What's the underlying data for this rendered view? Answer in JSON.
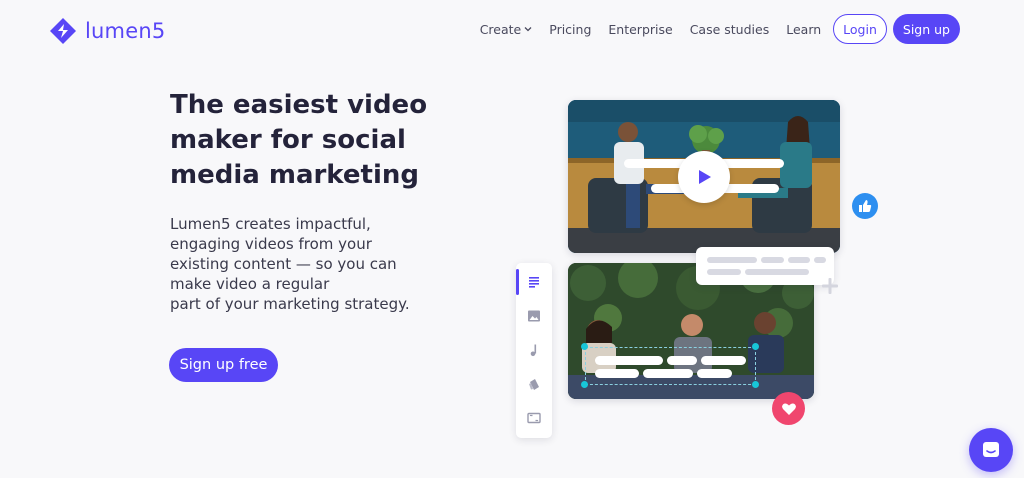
{
  "brand": {
    "name": "lumen5",
    "color": "#5846f6"
  },
  "nav": {
    "items": [
      {
        "label": "Create",
        "has_dropdown": true
      },
      {
        "label": "Pricing"
      },
      {
        "label": "Enterprise"
      },
      {
        "label": "Case studies"
      },
      {
        "label": "Learn"
      }
    ],
    "login_label": "Login",
    "signup_label": "Sign up"
  },
  "hero": {
    "title_lines": [
      "The easiest video",
      "maker for social",
      "media marketing"
    ],
    "subtitle_lines": [
      "Lumen5 creates impactful,",
      "engaging videos from your",
      "existing content — so you can",
      "make video a regular",
      "part of your marketing strategy."
    ],
    "cta_label": "Sign up free"
  },
  "illustration": {
    "icons": [
      "play-icon",
      "thumbs-up-icon",
      "heart-icon",
      "plus-icon"
    ],
    "toolbar_icons": [
      "text-icon",
      "image-icon",
      "music-icon",
      "style-icon",
      "aspect-ratio-icon"
    ],
    "active_tool": "text-icon"
  },
  "chat_widget": {
    "icon": "chat-icon"
  }
}
